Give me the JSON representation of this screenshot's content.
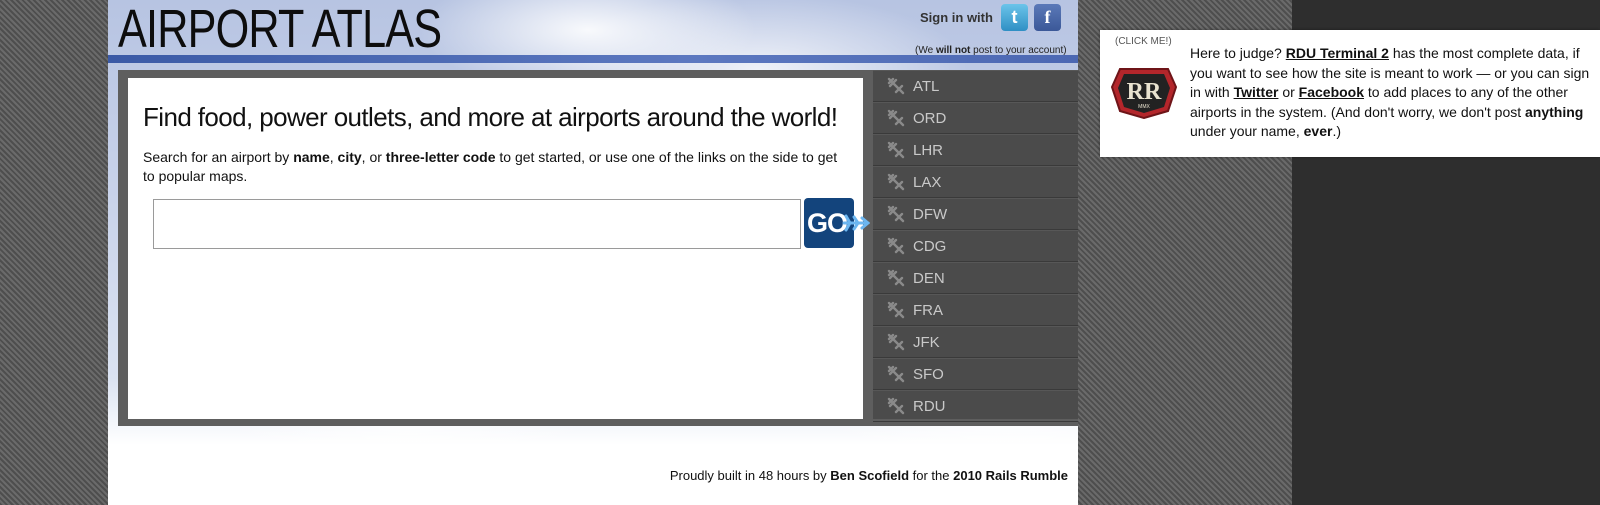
{
  "header": {
    "logo": "AIRPORT ATLAS",
    "sign_in_label": "Sign in with",
    "twitter_glyph": "t",
    "facebook_glyph": "f",
    "note_pre": "(We ",
    "note_bold": "will not",
    "note_post": " post to your account)"
  },
  "main": {
    "headline": "Find food, power outlets, and more at airports around the world!",
    "desc_1": "Search for an airport by ",
    "desc_name": "name",
    "desc_2": ", ",
    "desc_city": "city",
    "desc_3": ", or ",
    "desc_code": "three-letter code",
    "desc_4": " to get started, or use one of the links on the side to get to popular maps.",
    "search_value": "",
    "search_placeholder": "",
    "go_label": "GO"
  },
  "sidebar": {
    "icon": "airplane-icon",
    "items": [
      {
        "label": "ATL"
      },
      {
        "label": "ORD"
      },
      {
        "label": "LHR"
      },
      {
        "label": "LAX"
      },
      {
        "label": "DFW"
      },
      {
        "label": "CDG"
      },
      {
        "label": "DEN"
      },
      {
        "label": "FRA"
      },
      {
        "label": "JFK"
      },
      {
        "label": "SFO"
      },
      {
        "label": "RDU"
      }
    ]
  },
  "footer": {
    "pre": "Proudly built in 48 hours by ",
    "author": "Ben Scofield",
    "mid": " for the ",
    "event": "2010 Rails Rumble"
  },
  "judge": {
    "click_me": "(CLICK ME!)",
    "t1": "Here to judge? ",
    "link_rdu": "RDU Terminal 2",
    "t2": " has the most complete data, if you want to see how the site is meant to work — or you can sign in with ",
    "link_twitter": "Twitter",
    "t3": " or ",
    "link_facebook": "Facebook",
    "t4": " to add places to any of the other airports in the system. (And don't worry, we don't post ",
    "bold_anything": "anything",
    "t5": " under your name, ",
    "bold_ever": "ever",
    "t6": ".)",
    "badge_text": "RR",
    "badge_sub": "MMX"
  },
  "colors": {
    "go_button": "#13447c",
    "sidebar_bg": "#4b4b4b",
    "sidebar_text": "#c9c9c9",
    "twitter": "#3aa0d4",
    "facebook": "#3b5898",
    "badge_red": "#b3262b"
  }
}
